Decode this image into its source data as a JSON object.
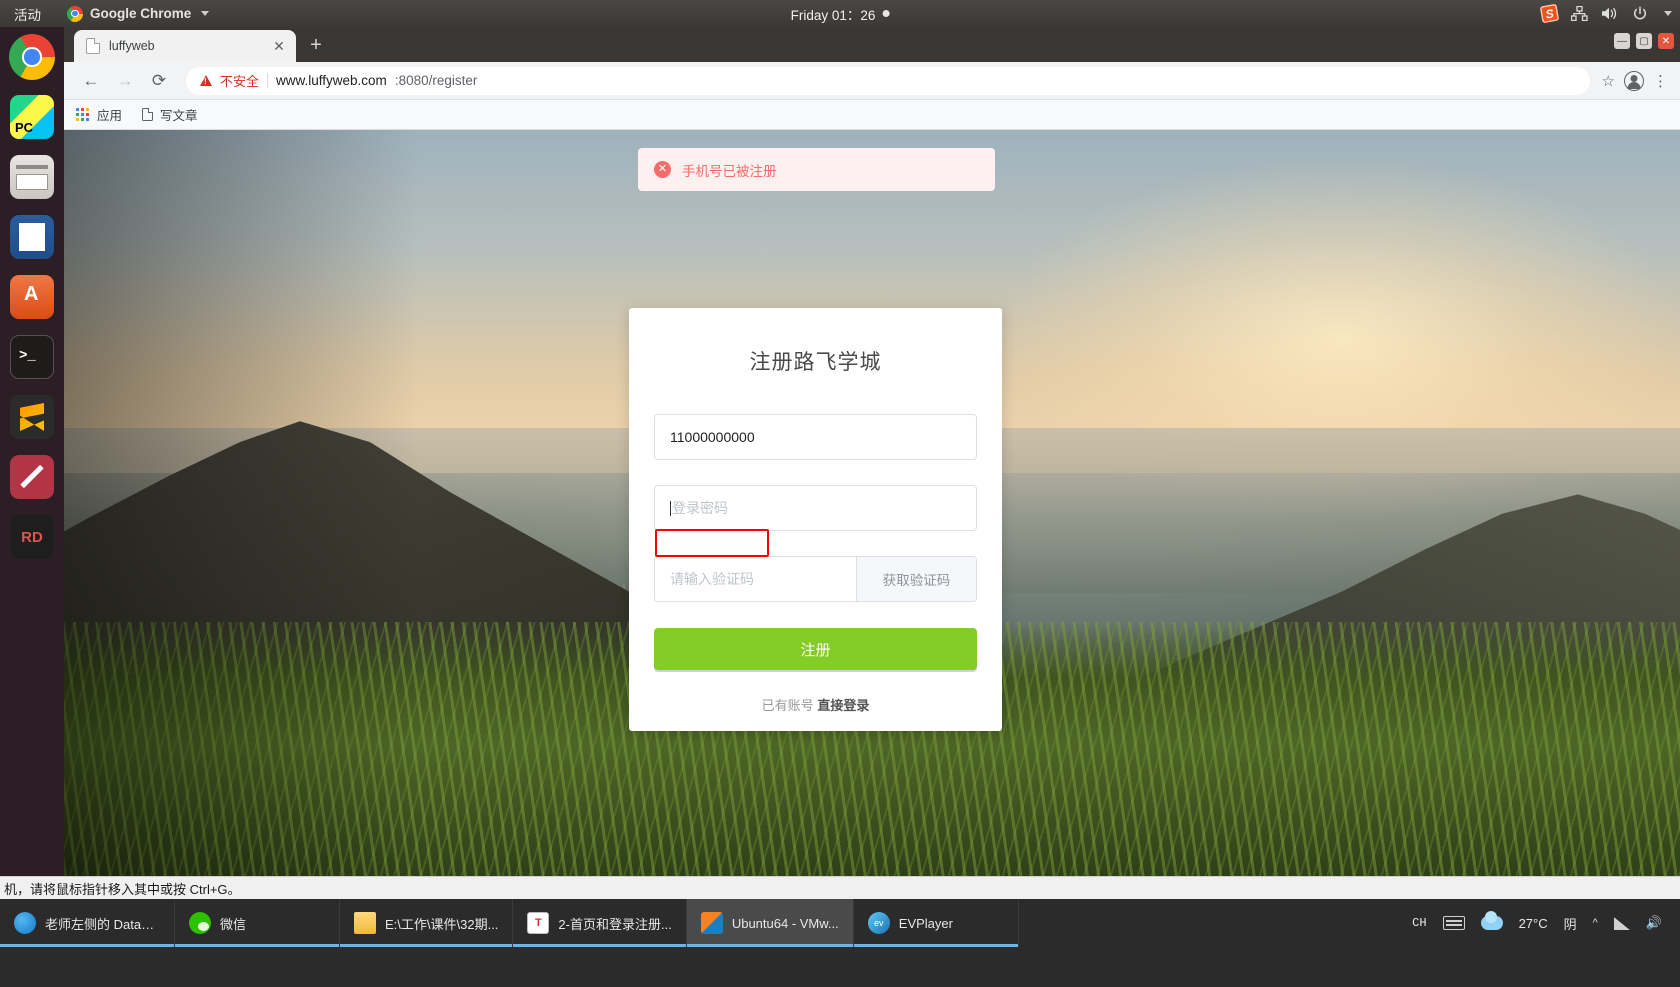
{
  "gnome": {
    "activities": "活动",
    "app_name": "Google Chrome",
    "clock": "Friday 01：26",
    "tray": [
      "sogou-input-icon",
      "network-icon",
      "volume-icon",
      "power-icon",
      "dropdown-icon"
    ]
  },
  "dock": {
    "items": [
      {
        "name": "chrome",
        "label": "Google Chrome"
      },
      {
        "name": "pycharm",
        "label": "PyCharm"
      },
      {
        "name": "files",
        "label": "Files"
      },
      {
        "name": "writer",
        "label": "LibreOffice Writer"
      },
      {
        "name": "software",
        "label": "Ubuntu Software"
      },
      {
        "name": "terminal",
        "label": "Terminal"
      },
      {
        "name": "sublime",
        "label": "Sublime Text"
      },
      {
        "name": "pen",
        "label": "Drawing"
      },
      {
        "name": "rd",
        "label": "RubyMine"
      }
    ]
  },
  "chrome": {
    "tab": {
      "title": "luffyweb",
      "close": "✕"
    },
    "new_tab": "+",
    "window_buttons": {
      "minimize": "—",
      "maximize": "▢",
      "close": "✕"
    },
    "nav": {
      "back": "←",
      "forward": "→",
      "reload": "⟳"
    },
    "omnibox": {
      "insecure_label": "不安全",
      "url_main": "www.luffyweb.com",
      "url_dim": ":8080/register"
    },
    "toolbar_right": {
      "star": "☆",
      "menu": "⋮"
    },
    "bookmarks": [
      {
        "name": "apps",
        "label": "应用"
      },
      {
        "name": "write-article",
        "label": "写文章"
      }
    ]
  },
  "page": {
    "alert": {
      "icon": "✕",
      "message": "手机号已被注册"
    },
    "card": {
      "title": "注册路飞学城",
      "phone_value": "11000000000",
      "password_placeholder": "登录密码",
      "captcha_placeholder": "请输入验证码",
      "captcha_button": "获取验证码",
      "submit_label": "注册",
      "footer_prefix": "已有账号",
      "footer_link": "直接登录"
    },
    "colors": {
      "submit_green": "#84cc28",
      "alert_bg": "#fdf0f0",
      "alert_text": "#f56c6c",
      "annotation_red": "#ff0000"
    }
  },
  "vm_status": "机，请将鼠标指针移入其中或按 Ctrl+G。",
  "taskbar": {
    "items": [
      {
        "name": "database-window",
        "label": "老师左侧的 DataB..."
      },
      {
        "name": "wechat-window",
        "label": "微信"
      },
      {
        "name": "explorer-window",
        "label": "E:\\工作\\课件\\32期..."
      },
      {
        "name": "ppt-window",
        "label": "2-首页和登录注册..."
      },
      {
        "name": "vmware-window",
        "label": "Ubuntu64 - VMw..."
      },
      {
        "name": "evplayer-window",
        "label": "EVPlayer"
      }
    ],
    "tray": {
      "ime": "CH",
      "temperature": "27°C",
      "weather": "阴",
      "expand": "^"
    }
  }
}
